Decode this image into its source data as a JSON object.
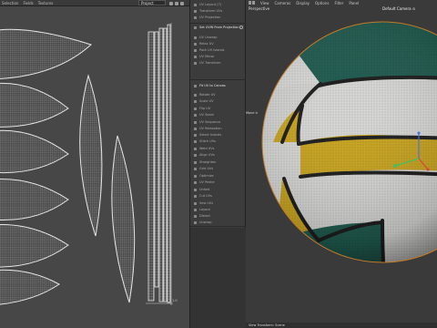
{
  "uv_editor": {
    "menu": [
      "Selection",
      "Fields",
      "Textures"
    ],
    "projection_dropdown": "Project",
    "scale_label": "1.0"
  },
  "tool_panel": {
    "items": [
      {
        "label": "UV Layout (7)",
        "bright": false,
        "gear": false
      },
      {
        "label": "Transform UVs",
        "bright": false,
        "gear": false
      },
      {
        "label": "UV Projection",
        "bright": false,
        "gear": false
      },
      {
        "label": "Set UVW From Projection",
        "bright": true,
        "gear": true
      },
      {
        "label": "UV Unwrap",
        "bright": false,
        "gear": false
      },
      {
        "label": "Relax UV",
        "bright": false,
        "gear": false
      },
      {
        "label": "Pack UV Islands",
        "bright": false,
        "gear": false
      },
      {
        "label": "UV Mirror",
        "bright": false,
        "gear": false
      },
      {
        "label": "UV Transform",
        "bright": false,
        "gear": false
      },
      {
        "label": "Fit UV to Canvas",
        "bright": true,
        "gear": false
      },
      {
        "label": "Rotate UV",
        "bright": false,
        "gear": false
      },
      {
        "label": "Scale UV",
        "bright": false,
        "gear": false
      },
      {
        "label": "Flip UV",
        "bright": false,
        "gear": false
      },
      {
        "label": "UV Seam",
        "bright": false,
        "gear": false
      },
      {
        "label": "UV Sequence",
        "bright": false,
        "gear": false
      },
      {
        "label": "UV Relaxation",
        "bright": false,
        "gear": false
      },
      {
        "label": "Select Islands",
        "bright": false,
        "gear": false
      },
      {
        "label": "Stitch UVs",
        "bright": false,
        "gear": false
      },
      {
        "label": "Weld UVs",
        "bright": false,
        "gear": false
      },
      {
        "label": "Align UVs",
        "bright": false,
        "gear": false
      },
      {
        "label": "Straighten",
        "bright": false,
        "gear": false
      },
      {
        "label": "Grid UVs",
        "bright": false,
        "gear": false
      },
      {
        "label": "Optimize",
        "bright": false,
        "gear": false
      },
      {
        "label": "UV Peeler",
        "bright": false,
        "gear": false
      },
      {
        "label": "Unfold",
        "bright": false,
        "gear": false
      },
      {
        "label": "Cut UVs",
        "bright": false,
        "gear": false
      },
      {
        "label": "Sew UVs",
        "bright": false,
        "gear": false
      },
      {
        "label": "Layout",
        "bright": false,
        "gear": false
      },
      {
        "label": "Distort",
        "bright": false,
        "gear": false
      },
      {
        "label": "Unwrap",
        "bright": false,
        "gear": false
      }
    ]
  },
  "viewport": {
    "menu": [
      "View",
      "Cameras",
      "Display",
      "Options",
      "Filter",
      "Panel"
    ],
    "view_label": "Perspective",
    "camera_label": "Default Camera ⊙",
    "side_label": "Move ⊙",
    "status": "View Transform: Scene"
  },
  "colors": {
    "ball_green": "#1f5a4e",
    "ball_yellow": "#c9a41f",
    "ball_white": "#d6d6d4",
    "seam": "#1b1b1b",
    "uv_wire": "#d7d7d7",
    "axis_x": "#e04040",
    "axis_y": "#40c060",
    "axis_z": "#4a6ee0"
  }
}
